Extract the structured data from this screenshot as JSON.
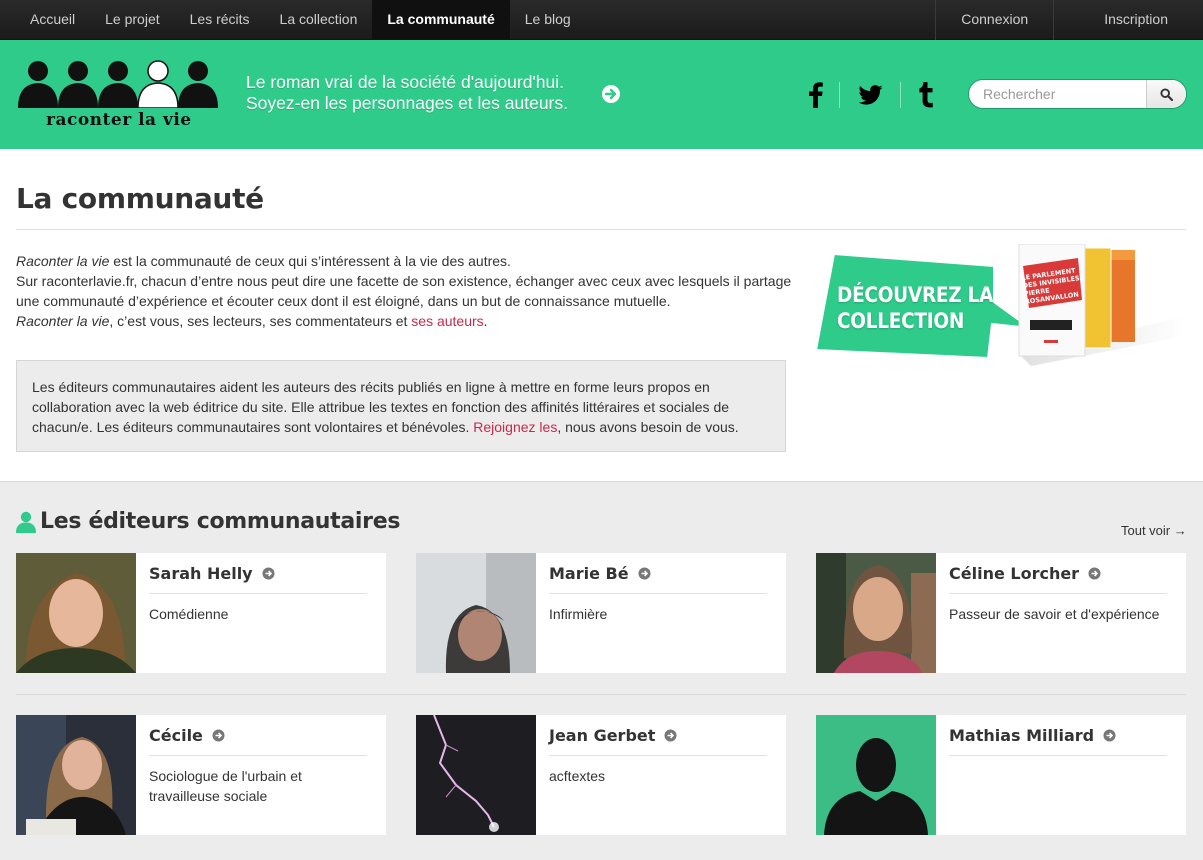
{
  "nav": {
    "items": [
      "Accueil",
      "Le projet",
      "Les récits",
      "La collection",
      "La communauté",
      "Le blog"
    ],
    "active": "La communauté",
    "login": "Connexion",
    "signup": "Inscription"
  },
  "header": {
    "logo_text": "raconter la vie",
    "tagline_line1": "Le roman vrai de la société d'aujourd'hui.",
    "tagline_line2": "Soyez-en les personnages et les auteurs.",
    "social": [
      "facebook-icon",
      "twitter-icon",
      "tumblr-icon"
    ],
    "search_placeholder": "Rechercher"
  },
  "page": {
    "title": "La communauté",
    "intro": {
      "l1_em": "Raconter la vie",
      "l1_rest": " est la communauté de ceux qui s’intéressent à la vie des autres.",
      "l2": "Sur raconterlavie.fr, chacun d’entre nous peut dire une facette de son existence, échanger avec ceux avec lesquels il partage une communauté d’expérience et écouter ceux dont il est éloigné, dans un but de connaissance mutuelle.",
      "l3_em": "Raconter la vie",
      "l3_rest": ", c’est vous, ses lecteurs, ses commentateurs et ",
      "l3_link": "ses auteurs",
      "l3_end": "."
    },
    "callout": {
      "text": "Les éditeurs communautaires aident les auteurs des récits publiés en ligne à mettre en forme leurs propos en collaboration avec la web éditrice du site. Elle attribue les textes en fonction des affinités littéraires et sociales de chacun/e. Les éditeurs communautaires sont volontaires et bénévoles. ",
      "link": "Rejoignez les",
      "end": ", nous avons besoin de vous."
    },
    "promo": {
      "line1": "DÉCOUVREZ LA",
      "line2": "COLLECTION",
      "book_title": "LE PARLEMENT DES INVISIBLES",
      "book_author": "PIERRE ROSANVALLON"
    }
  },
  "community": {
    "title": "Les éditeurs communautaires",
    "see_all": "Tout voir →",
    "editors": [
      {
        "name": "Sarah Helly",
        "role": "Comédienne"
      },
      {
        "name": "Marie Bé",
        "role": "Infirmière"
      },
      {
        "name": "Céline Lorcher",
        "role": "Passeur de savoir et d'expérience"
      },
      {
        "name": "Cécile",
        "role": "Sociologue de l'urbain et travailleuse sociale"
      },
      {
        "name": "Jean Gerbet",
        "role": "acftextes"
      },
      {
        "name": "Mathias Milliard",
        "role": ""
      }
    ]
  },
  "colors": {
    "brand_green": "#2fcb8b",
    "nav_dark": "#1b1b1b",
    "link_red": "#c8294a"
  }
}
